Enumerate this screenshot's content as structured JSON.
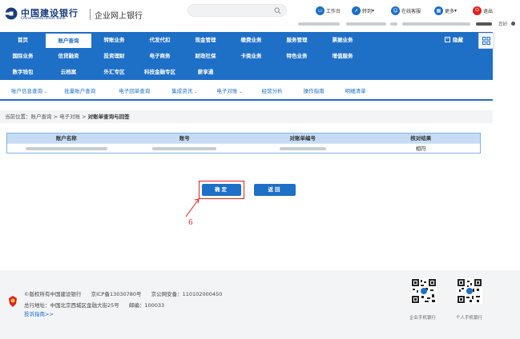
{
  "header": {
    "bank_name_cn": "中国建设银行",
    "bank_name_en": "China Construction Bank",
    "product": "企业网上银行",
    "tools": [
      {
        "label": "工作台",
        "icon": "desk-icon",
        "color": "#1e6fc6"
      },
      {
        "label": "转到",
        "icon": "goto-icon",
        "color": "#1e6fc6"
      },
      {
        "label": "在线客服",
        "icon": "service-icon",
        "color": "#1e6fc6"
      },
      {
        "label": "更多",
        "icon": "more-icon",
        "color": "#1e6fc6"
      },
      {
        "label": "退出",
        "icon": "power-icon",
        "color": "#e02020"
      }
    ],
    "greeting": "您好:"
  },
  "nav": {
    "row1": [
      "首页",
      "账户查询",
      "转账业务",
      "代发代扣",
      "现金管理",
      "缴费业务",
      "服务管理",
      "票据业务"
    ],
    "row2": [
      "国际业务",
      "信贷融资",
      "投资理财",
      "电子商务",
      "财政社保",
      "卡类业务",
      "特色业务",
      "增值服务"
    ],
    "row3": [
      "数字钱包",
      "云档案",
      "外汇专区",
      "科技金融专区",
      "薪享通"
    ],
    "active": "账户查询",
    "collapse_label": "隐藏"
  },
  "subnav": {
    "items": [
      "账户信息查询",
      "批量账户查询",
      "电子回单查询",
      "集成资讯",
      "电子对账",
      "经营分析",
      "操作指南",
      "明细清单"
    ]
  },
  "breadcrumb": {
    "prefix": "当前位置：账户查询 > 电子对账 > ",
    "current": "对账单查询与回签"
  },
  "table": {
    "headers": [
      "账户名称",
      "账号",
      "对账单编号",
      "核对结果"
    ],
    "rows": [
      {
        "result": "相符"
      }
    ]
  },
  "buttons": {
    "confirm": "确定",
    "back": "返回"
  },
  "annotation": {
    "number": "6"
  },
  "footer": {
    "copyright": "©版权所有中国建设银行",
    "icp": "京ICP备13030780号",
    "police": "京公网安备：110102000450",
    "address": "总行地址：中国北京西城区金融大街25号",
    "zip": "邮编：100033",
    "complaint": "投诉指南>>",
    "qr_labels": [
      "企业手机银行",
      "个人手机银行"
    ]
  },
  "colors": {
    "primary": "#1e6fc6",
    "annotation": "#e02020"
  }
}
